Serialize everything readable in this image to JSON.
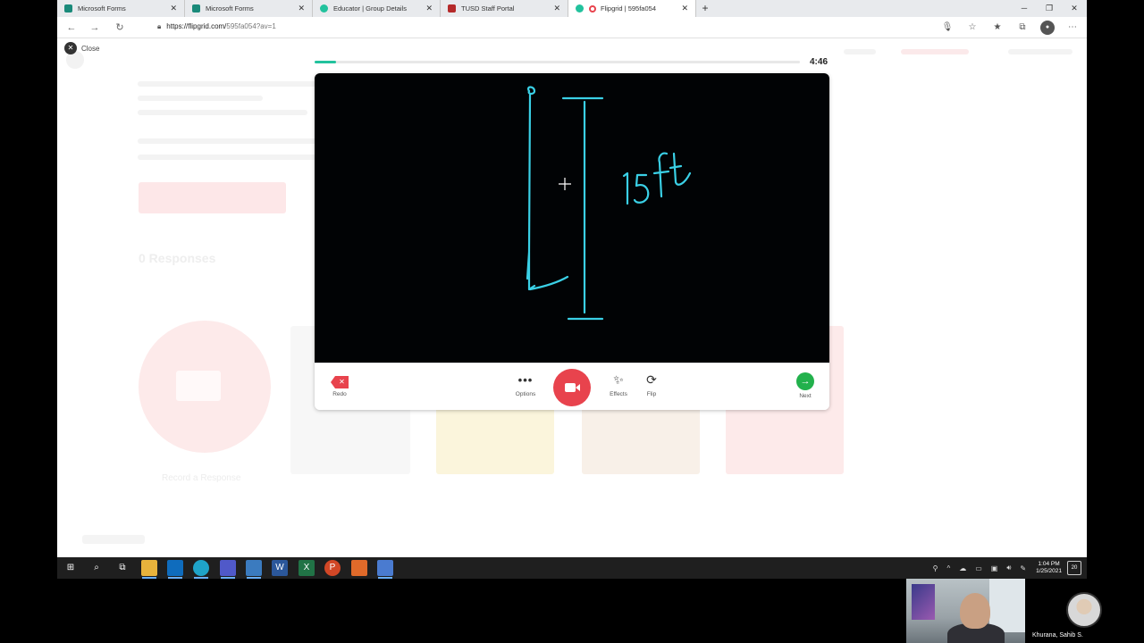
{
  "browser": {
    "tabs": [
      {
        "label": "Microsoft Forms",
        "color": "#1a8a7a",
        "active": false
      },
      {
        "label": "Microsoft Forms",
        "color": "#1a8a7a",
        "active": false
      },
      {
        "label": "Educator | Group Details",
        "color": "#22c29d",
        "active": false
      },
      {
        "label": "TUSD Staff Portal",
        "color": "#b52a2a",
        "active": false
      },
      {
        "label": "Flipgrid | 595fa054",
        "color": "#22c29d",
        "active": true
      }
    ],
    "url_host": "https://flipgrid.com/",
    "url_path": "595fa054?av=1"
  },
  "page": {
    "close_label": "Close",
    "bg_title": "0 Responses",
    "bg_record_label": "Record a Response"
  },
  "recorder": {
    "progress_fraction": 0.045,
    "timer": "4:46",
    "drawing_text": "15ft",
    "controls": {
      "redo": "Redo",
      "options": "Options",
      "effects": "Effects",
      "flip": "Flip",
      "next": "Next"
    }
  },
  "taskbar": {
    "time": "1:04 PM",
    "date": "1/25/2021",
    "notifications": "20"
  },
  "call": {
    "participant_name": "Khurana, Sahib S."
  }
}
